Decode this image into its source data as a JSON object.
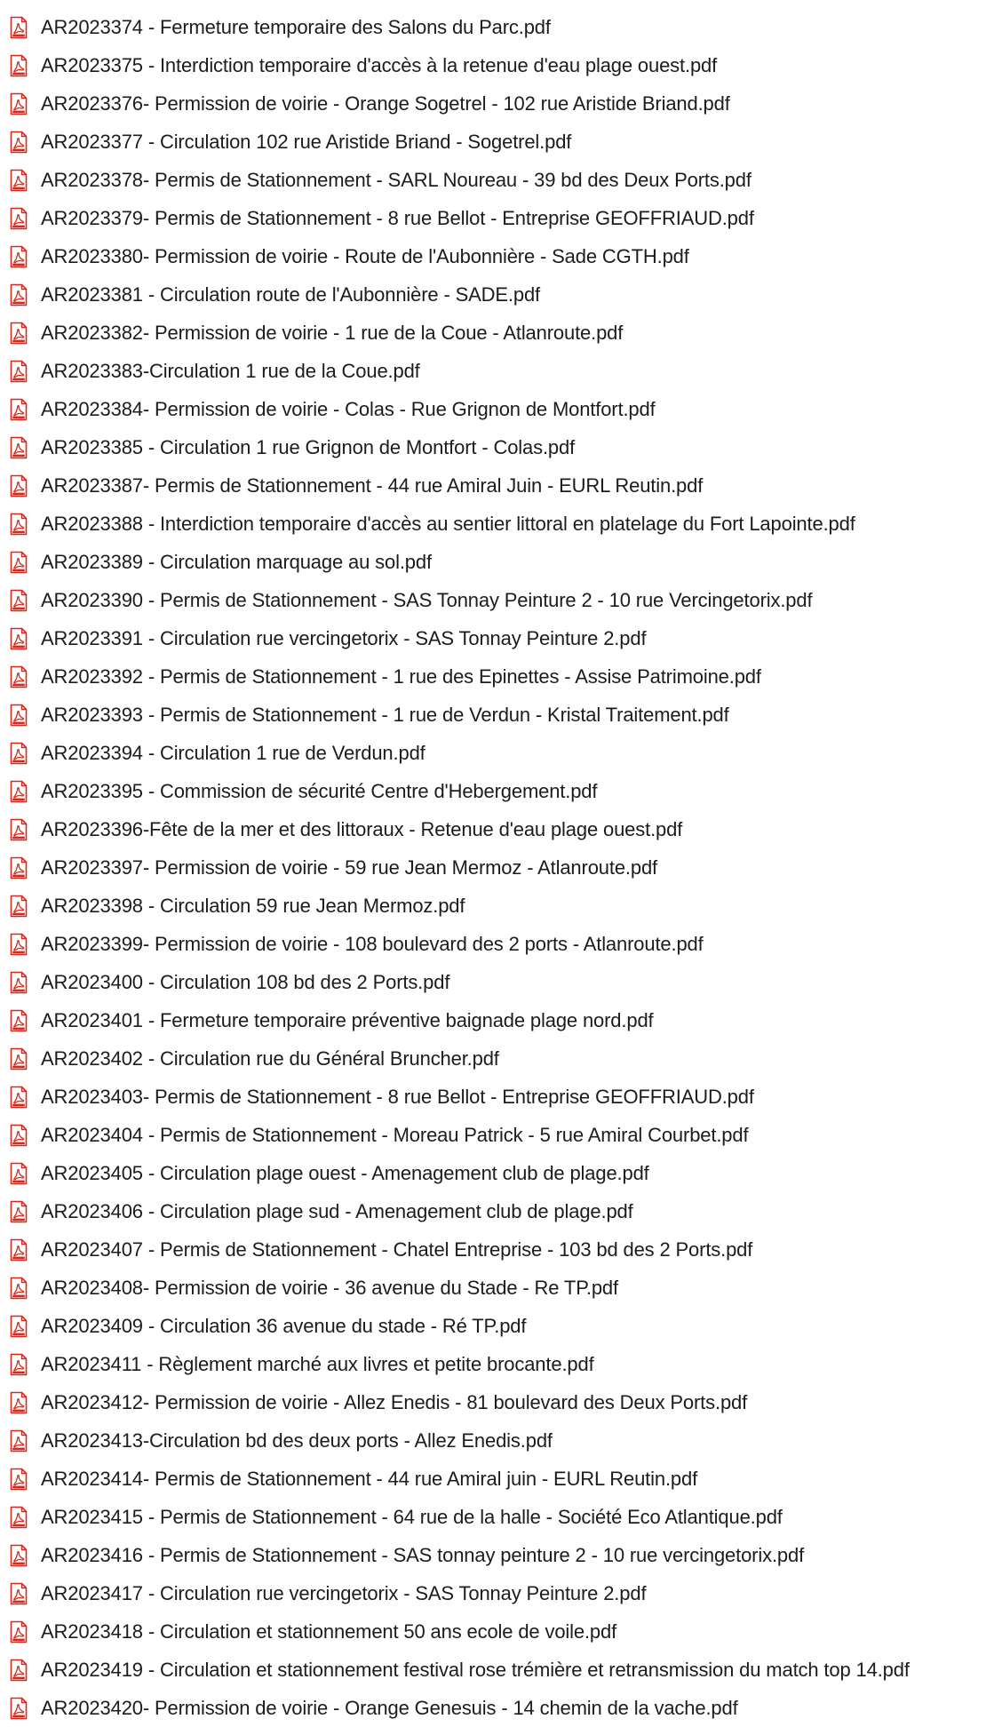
{
  "colors": {
    "icon_red": "#d52b1e",
    "icon_page": "#ffffff",
    "text": "#1c1c1c",
    "background": "#ffffff"
  },
  "file_icon": "pdf-file-icon",
  "files": [
    {
      "name": "AR2023374 - Fermeture temporaire des Salons du Parc.pdf"
    },
    {
      "name": "AR2023375 - Interdiction temporaire d'accès à la retenue d'eau plage ouest.pdf"
    },
    {
      "name": "AR2023376- Permission de voirie - Orange Sogetrel - 102 rue Aristide Briand.pdf"
    },
    {
      "name": "AR2023377 - Circulation 102 rue Aristide Briand - Sogetrel.pdf"
    },
    {
      "name": "AR2023378- Permis de Stationnement - SARL Noureau - 39 bd des Deux Ports.pdf"
    },
    {
      "name": "AR2023379- Permis de Stationnement - 8 rue Bellot - Entreprise GEOFFRIAUD.pdf"
    },
    {
      "name": "AR2023380- Permission de voirie - Route de l'Aubonnière - Sade CGTH.pdf"
    },
    {
      "name": "AR2023381 - Circulation route de l'Aubonnière - SADE.pdf"
    },
    {
      "name": "AR2023382- Permission de voirie - 1 rue de la Coue - Atlanroute.pdf"
    },
    {
      "name": "AR2023383-Circulation 1 rue de la Coue.pdf"
    },
    {
      "name": "AR2023384- Permission de voirie - Colas - Rue Grignon de Montfort.pdf"
    },
    {
      "name": "AR2023385 - Circulation 1 rue Grignon de Montfort - Colas.pdf"
    },
    {
      "name": "AR2023387- Permis de Stationnement - 44 rue Amiral Juin - EURL Reutin.pdf"
    },
    {
      "name": "AR2023388 - Interdiction temporaire d'accès au sentier littoral en platelage du Fort Lapointe.pdf"
    },
    {
      "name": "AR2023389 - Circulation marquage au sol.pdf"
    },
    {
      "name": "AR2023390 - Permis de Stationnement - SAS Tonnay Peinture 2 - 10 rue Vercingetorix.pdf"
    },
    {
      "name": "AR2023391 - Circulation rue vercingetorix - SAS Tonnay Peinture 2.pdf"
    },
    {
      "name": "AR2023392 - Permis de Stationnement - 1 rue des Epinettes - Assise Patrimoine.pdf"
    },
    {
      "name": "AR2023393 - Permis de Stationnement - 1 rue de Verdun - Kristal Traitement.pdf"
    },
    {
      "name": "AR2023394 - Circulation 1 rue de Verdun.pdf"
    },
    {
      "name": "AR2023395 - Commission de sécurité Centre d'Hebergement.pdf"
    },
    {
      "name": "AR2023396-Fête de la mer et des littoraux - Retenue d'eau plage ouest.pdf"
    },
    {
      "name": "AR2023397- Permission de voirie - 59 rue Jean Mermoz - Atlanroute.pdf"
    },
    {
      "name": "AR2023398 - Circulation 59 rue Jean Mermoz.pdf"
    },
    {
      "name": "AR2023399- Permission de voirie - 108 boulevard des 2 ports - Atlanroute.pdf"
    },
    {
      "name": "AR2023400 - Circulation 108 bd des 2 Ports.pdf"
    },
    {
      "name": "AR2023401 -  Fermeture temporaire préventive baignade plage nord.pdf"
    },
    {
      "name": "AR2023402 - Circulation rue du Général Bruncher.pdf"
    },
    {
      "name": "AR2023403- Permis de Stationnement - 8 rue Bellot - Entreprise GEOFFRIAUD.pdf"
    },
    {
      "name": "AR2023404 - Permis de Stationnement - Moreau Patrick - 5 rue Amiral Courbet.pdf"
    },
    {
      "name": "AR2023405 - Circulation plage ouest - Amenagement club de plage.pdf"
    },
    {
      "name": "AR2023406 - Circulation plage sud - Amenagement club de plage.pdf"
    },
    {
      "name": "AR2023407 - Permis de Stationnement - Chatel Entreprise - 103 bd des 2 Ports.pdf"
    },
    {
      "name": "AR2023408- Permission de voirie - 36 avenue du Stade - Re TP.pdf"
    },
    {
      "name": "AR2023409 - Circulation 36 avenue du stade - Ré TP.pdf"
    },
    {
      "name": "AR2023411 - Règlement marché aux livres et petite brocante.pdf"
    },
    {
      "name": "AR2023412- Permission de voirie - Allez Enedis - 81 boulevard des Deux Ports.pdf"
    },
    {
      "name": "AR2023413-Circulation bd des deux ports - Allez Enedis.pdf"
    },
    {
      "name": "AR2023414- Permis de Stationnement - 44 rue Amiral juin - EURL Reutin.pdf"
    },
    {
      "name": "AR2023415 - Permis de Stationnement - 64 rue de la halle - Société Eco Atlantique.pdf"
    },
    {
      "name": "AR2023416 - Permis de Stationnement - SAS tonnay peinture 2 - 10 rue vercingetorix.pdf"
    },
    {
      "name": "AR2023417 - Circulation rue vercingetorix - SAS Tonnay Peinture 2.pdf"
    },
    {
      "name": "AR2023418 - Circulation et stationnement 50 ans ecole de voile.pdf"
    },
    {
      "name": "AR2023419 - Circulation et stationnement festival rose trémière et retransmission du match top 14.pdf"
    },
    {
      "name": "AR2023420- Permission de voirie - Orange Genesuis - 14 chemin de la vache.pdf"
    }
  ]
}
